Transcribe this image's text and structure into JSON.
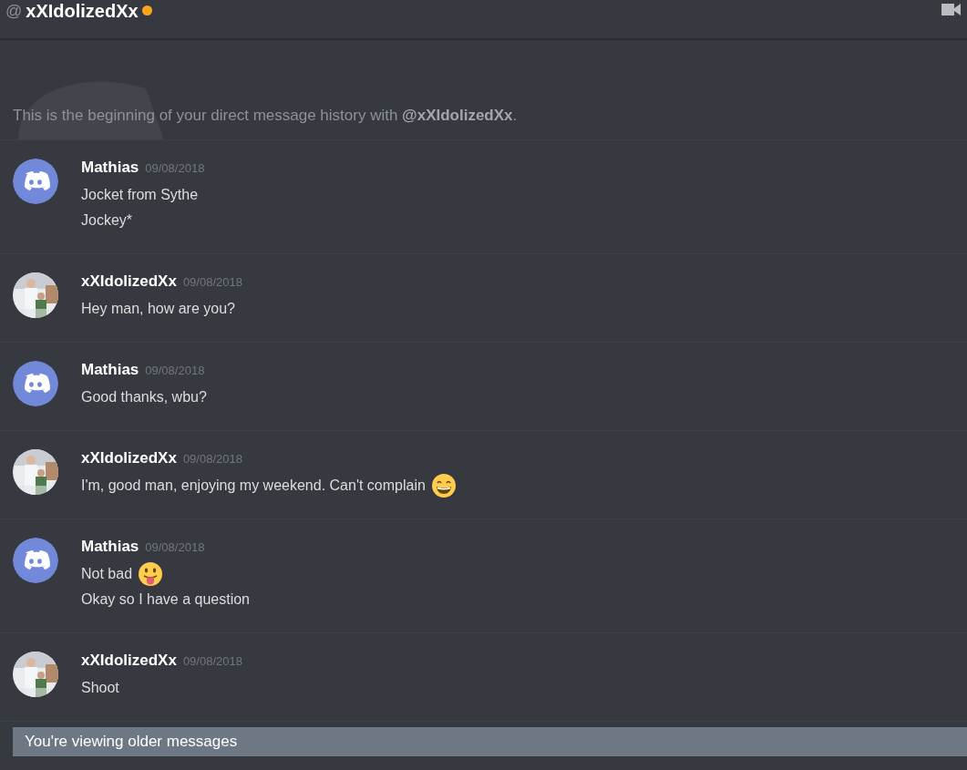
{
  "header": {
    "at": "@",
    "name": "xXIdolizedXx",
    "status_dot": {
      "color": "#faa61a"
    }
  },
  "intro": "This is the beginning of your direct message history with **@xXIdolizedXx**.",
  "messages": [
    {
      "avatar": {
        "kind": "logo"
      },
      "author": "Mathias",
      "time": "09/08/2018",
      "lines": [
        {
          "text": "Jocket from Sythe"
        },
        {
          "text": "Jockey*"
        }
      ]
    },
    {
      "avatar": {
        "kind": "picture"
      },
      "author": "xXIdolizedXx",
      "time": "09/08/2018",
      "lines": [
        {
          "text": "Hey man, how are you?"
        }
      ]
    },
    {
      "avatar": {
        "kind": "logo"
      },
      "author": "Mathias",
      "time": "09/08/2018",
      "lines": [
        {
          "text": "Good thanks, wbu?"
        }
      ]
    },
    {
      "avatar": {
        "kind": "picture"
      },
      "author": "xXIdolizedXx",
      "time": "09/08/2018",
      "lines": [
        {
          "text": "I'm, good man, enjoying my weekend. Can't complain",
          "emoji": {
            "kind": "grin"
          }
        }
      ]
    },
    {
      "avatar": {
        "kind": "logo"
      },
      "author": "Mathias",
      "time": "09/08/2018",
      "lines": [
        {
          "text": "Not bad",
          "emoji": {
            "kind": "tongue"
          }
        },
        {
          "text": "Okay so I have a question"
        }
      ]
    },
    {
      "avatar": {
        "kind": "picture"
      },
      "author": "xXIdolizedXx",
      "time": "09/08/2018",
      "lines": [
        {
          "text": "Shoot"
        }
      ]
    }
  ],
  "banner": "You're viewing older messages"
}
